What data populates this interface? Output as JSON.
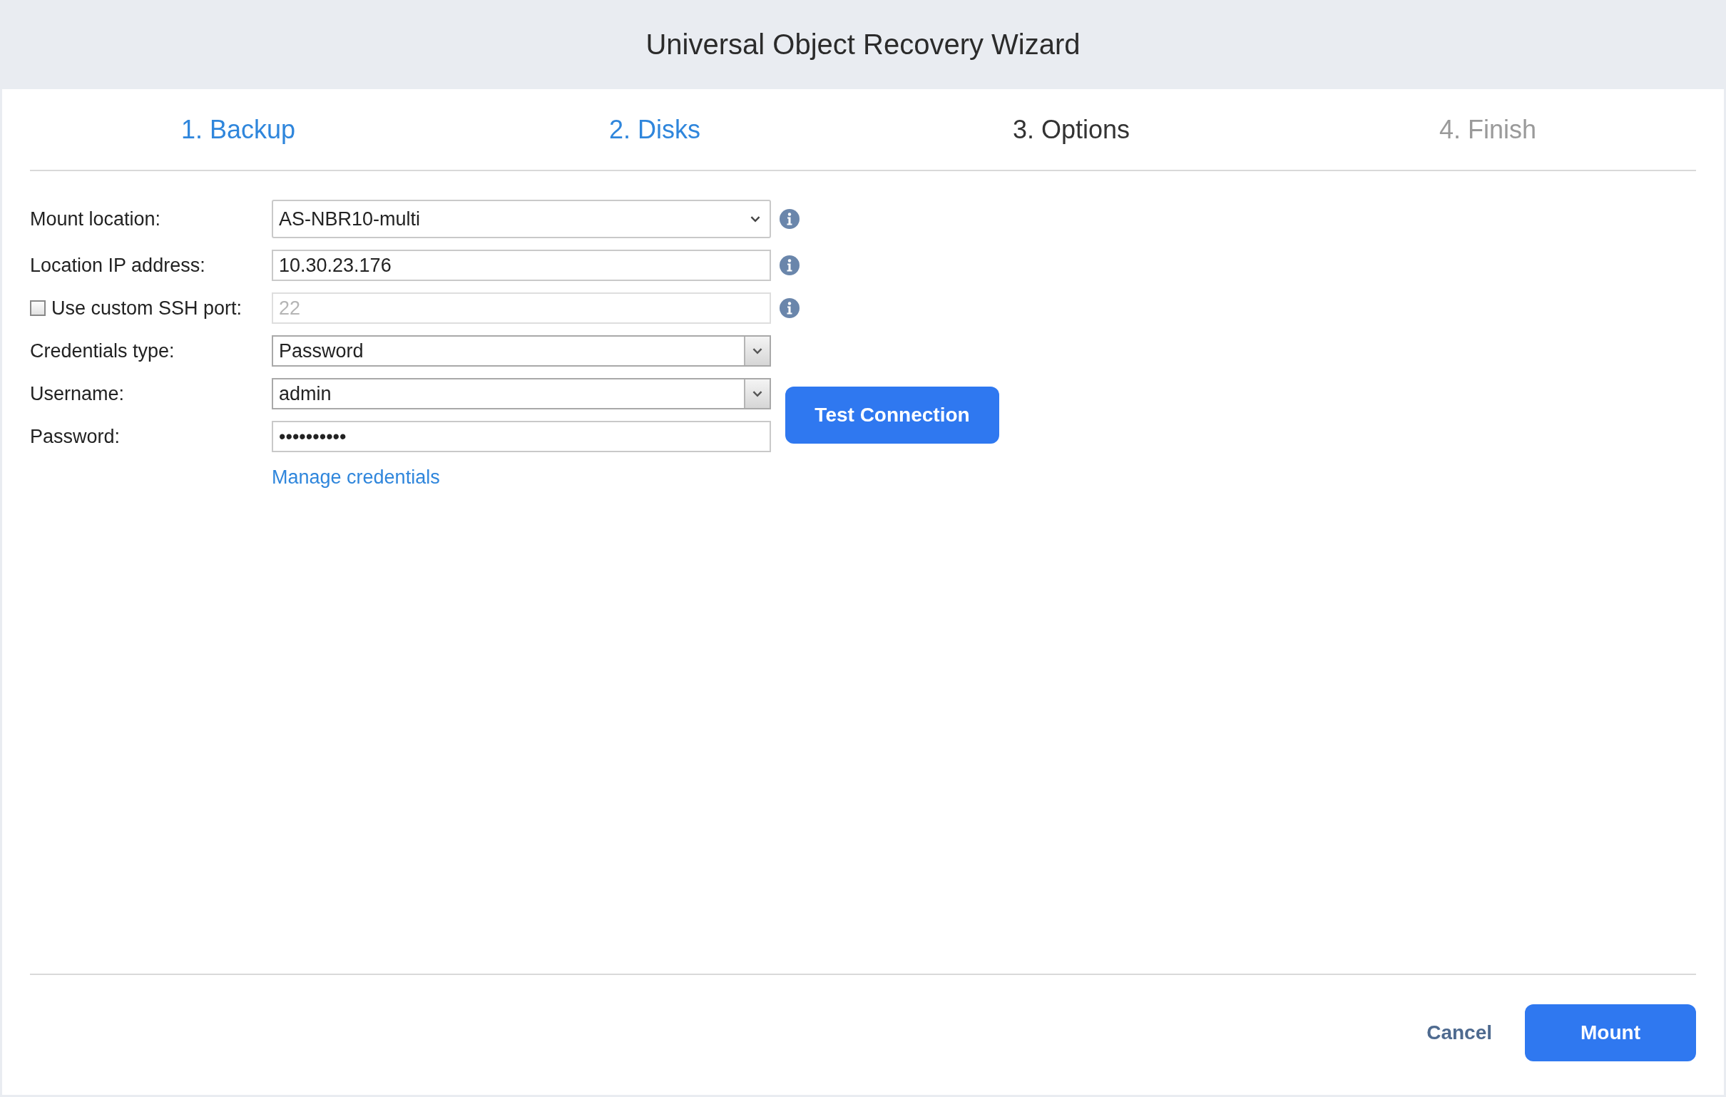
{
  "window": {
    "title": "Universal Object Recovery Wizard"
  },
  "steps": [
    {
      "label": "1. Backup",
      "completed": true,
      "selected": false
    },
    {
      "label": "2. Disks",
      "completed": true,
      "selected": false
    },
    {
      "label": "3. Options",
      "completed": false,
      "selected": true
    },
    {
      "label": "4. Finish",
      "completed": false,
      "selected": false
    }
  ],
  "fields": [
    {
      "kind": "select",
      "label": "Mount location:",
      "value": "AS-NBR10-multi",
      "disabled": false,
      "info": true
    },
    {
      "kind": "text",
      "label": "Location IP address:",
      "value": "10.30.23.176",
      "disabled": false,
      "info": true
    },
    {
      "kind": "text",
      "label": "Use custom SSH port:",
      "checkbox": {
        "checked": false
      },
      "value": "22",
      "disabled": true,
      "info": true
    },
    {
      "kind": "combo",
      "label": "Credentials type:",
      "value": "Password",
      "disabled": false
    },
    {
      "kind": "combo",
      "label": "Username:",
      "value": "admin",
      "disabled": false
    },
    {
      "kind": "password",
      "label": "Password:",
      "value": "••••••••••",
      "disabled": false
    }
  ],
  "test_button": "Test Connection",
  "manage_link": "Manage credentials",
  "footer": {
    "cancel": "Cancel",
    "mount": "Mount"
  }
}
